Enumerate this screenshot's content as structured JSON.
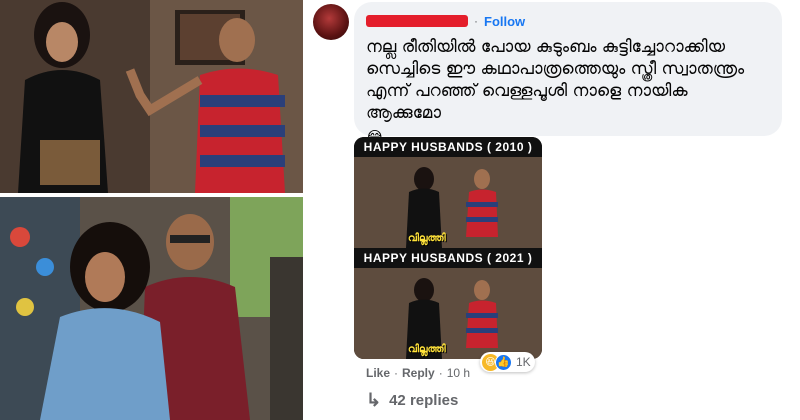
{
  "comment": {
    "follow_label": "Follow",
    "separator": "·",
    "text": "നല്ല രീതിയിൽ പോയ കുടുംബം കുട്ടിച്ചോറാക്കിയ സെച്ചിടെ ഈ കഥാപാത്രത്തെയും സ്ത്രീ സ്വാതന്ത്രം എന്ന് പറഞ്ഞ് വെള്ളപൂശി നാളെ നായിക ആക്കുമോ",
    "emoji": "😂"
  },
  "meme": {
    "top_title": "HAPPY HUSBANDS ( 2010 )",
    "bottom_title": "HAPPY HUSBANDS ( 2021 )",
    "caption_top": "വില്ലത്തി",
    "caption_bottom": "വില്ലത്തി"
  },
  "reactions": {
    "count": "1K",
    "icons": [
      "haha-icon",
      "like-icon"
    ]
  },
  "actions": {
    "like_label": "Like",
    "reply_label": "Reply",
    "time": "10 h",
    "separator": "·"
  },
  "replies": {
    "label": "42 replies"
  },
  "colors": {
    "bubble": "#f0f2f5",
    "link": "#1877f2",
    "muted": "#65676b",
    "redacted_name": "#e41e2b"
  }
}
